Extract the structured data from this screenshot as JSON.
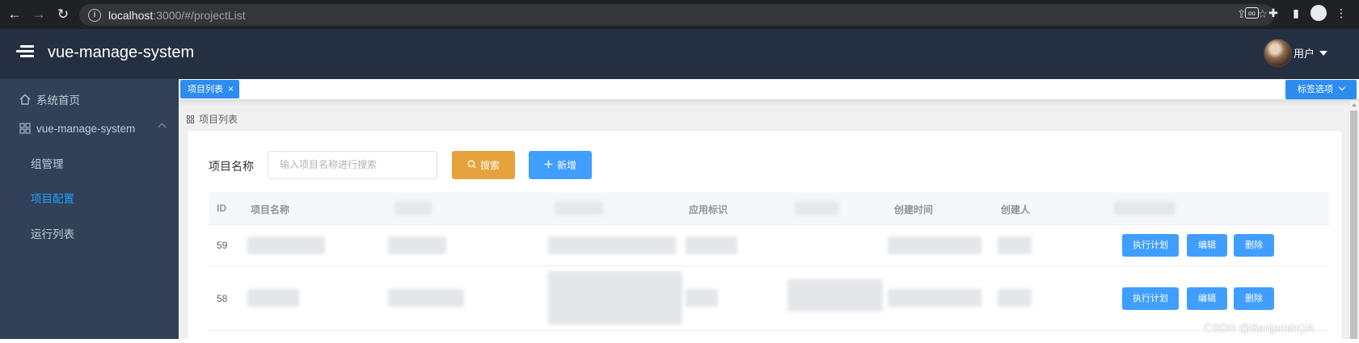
{
  "browser": {
    "url_host": "localhost",
    "url_path": ":3000/#/projectList"
  },
  "header": {
    "title": "vue-manage-system",
    "user_name": "用户"
  },
  "sidebar": {
    "items": [
      {
        "label": "系统首页"
      },
      {
        "label": "vue-manage-system"
      }
    ],
    "sub_items": [
      {
        "label": "组管理"
      },
      {
        "label": "项目配置"
      },
      {
        "label": "运行列表"
      }
    ]
  },
  "tags": {
    "active_tag": "项目列表",
    "close_glyph": "×",
    "menu_label": "标签选项"
  },
  "breadcrumb": {
    "label": "项目列表"
  },
  "search": {
    "label": "项目名称",
    "placeholder": "输入项目名称进行搜索",
    "search_button": "搜索",
    "add_button": "新增"
  },
  "table": {
    "columns": [
      "ID",
      "项目名称",
      "应用标识",
      "创建时间",
      "创建人"
    ],
    "rows": [
      {
        "id": "59"
      },
      {
        "id": "58"
      }
    ],
    "actions": {
      "plan": "执行计划",
      "edit": "编辑",
      "delete": "删除"
    }
  },
  "watermark": "CSDN @BenjaminQA",
  "colors": {
    "header_bg": "#242f42",
    "sidebar_bg": "#324157",
    "active_menu": "#20a0ff",
    "primary": "#409eff",
    "warning": "#e6a23c"
  }
}
